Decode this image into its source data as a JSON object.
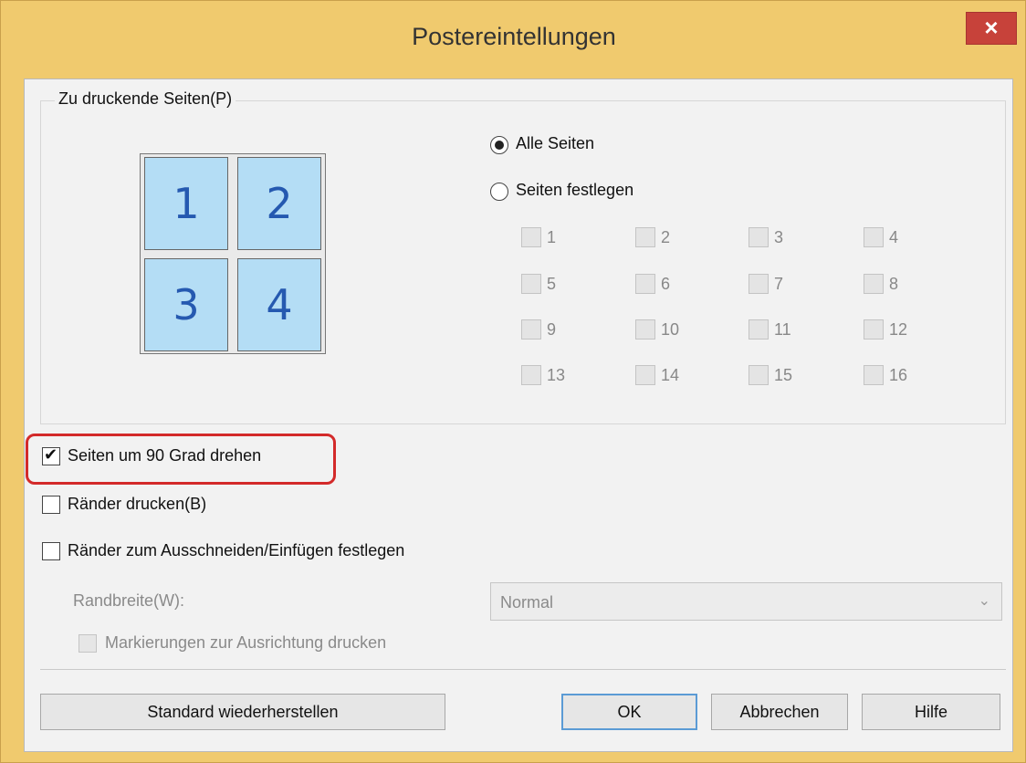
{
  "window": {
    "title": "Postereintellungen",
    "close_glyph": "×"
  },
  "pages_group": {
    "label": "Zu druckende Seiten(P)",
    "preview_tiles": [
      "1",
      "2",
      "3",
      "4"
    ],
    "radio_all": "Alle Seiten",
    "radio_specify": "Seiten festlegen",
    "selected_radio": "Alle Seiten",
    "page_checkboxes": [
      "1",
      "2",
      "3",
      "4",
      "5",
      "6",
      "7",
      "8",
      "9",
      "10",
      "11",
      "12",
      "13",
      "14",
      "15",
      "16"
    ]
  },
  "options": {
    "rotate": {
      "label": "Seiten um 90 Grad drehen",
      "checked": true
    },
    "print_borders": {
      "label": "Ränder drucken(B)",
      "checked": false
    },
    "cut_paste_margins": {
      "label": "Ränder zum Ausschneiden/Einfügen festlegen",
      "checked": false
    },
    "margin_width_label": "Randbreite(W):",
    "margin_width_value": "Normal",
    "alignment_marks": {
      "label": "Markierungen zur Ausrichtung drucken",
      "checked": false
    }
  },
  "buttons": {
    "restore_defaults": "Standard wiederherstellen",
    "ok": "OK",
    "cancel": "Abbrechen",
    "help": "Hilfe"
  },
  "colors": {
    "titlebar": "#f0ca6e",
    "close": "#c7423a",
    "tile": "#b4ddf5",
    "tile_text": "#2559b0",
    "highlight": "#d32a2a"
  }
}
